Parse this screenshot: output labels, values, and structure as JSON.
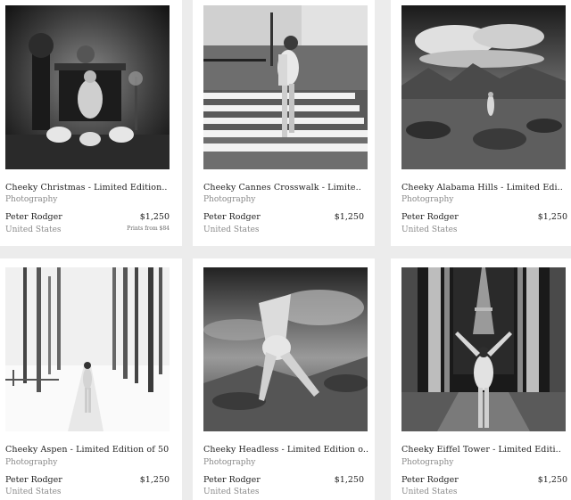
{
  "listings": [
    {
      "title": "Cheeky Christmas - Limited Edition..",
      "category": "Photography",
      "artist": "Peter Rodger",
      "price": "$1,250",
      "country": "United States",
      "prints": "Prints from $84"
    },
    {
      "title": "Cheeky Cannes Crosswalk - Limite..",
      "category": "Photography",
      "artist": "Peter Rodger",
      "price": "$1,250",
      "country": "United States"
    },
    {
      "title": "Cheeky Alabama Hills - Limited Edi..",
      "category": "Photography",
      "artist": "Peter Rodger",
      "price": "$1,250",
      "country": "United States"
    },
    {
      "title": "Cheeky Aspen - Limited Edition of 50",
      "category": "Photography",
      "artist": "Peter Rodger",
      "price": "$1,250",
      "country": "United States"
    },
    {
      "title": "Cheeky Headless - Limited Edition o..",
      "category": "Photography",
      "artist": "Peter Rodger",
      "price": "$1,250",
      "country": "United States"
    },
    {
      "title": "Cheeky Eiffel Tower - Limited Editi..",
      "category": "Photography",
      "artist": "Peter Rodger",
      "price": "$1,250",
      "country": "United States"
    }
  ]
}
